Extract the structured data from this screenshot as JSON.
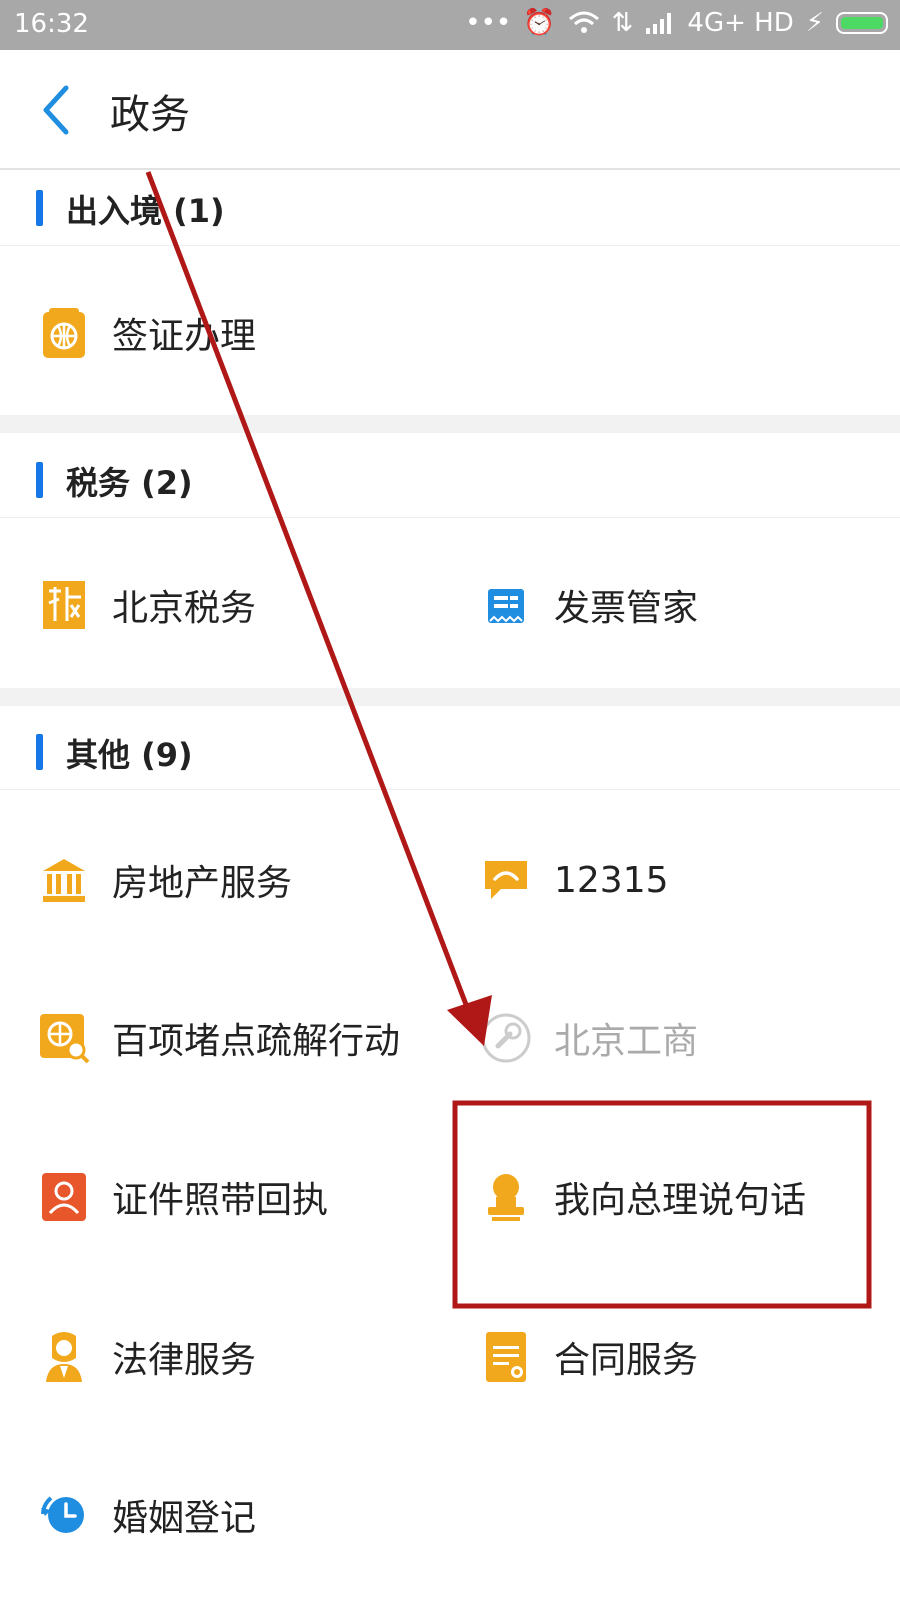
{
  "status_bar": {
    "time": "16:32",
    "network": "4G+ HD"
  },
  "header": {
    "title": "政务"
  },
  "sections": [
    {
      "title": "出入境 (1)",
      "items": [
        {
          "label": "签证办理",
          "icon": "passport-globe-icon",
          "color": "#f2a81d"
        }
      ]
    },
    {
      "title": "税务 (2)",
      "items": [
        {
          "label": "北京税务",
          "icon": "tax-stamp-icon",
          "color": "#f2a81d"
        },
        {
          "label": "发票管家",
          "icon": "invoice-icon",
          "color": "#1f8de0"
        }
      ]
    },
    {
      "title": "其他 (9)",
      "items": [
        {
          "label": "房地产服务",
          "icon": "bank-building-icon",
          "color": "#f2a81d"
        },
        {
          "label": "12315",
          "icon": "speech-bubble-icon",
          "color": "#f2a81d"
        },
        {
          "label": "百项堵点疏解行动",
          "icon": "globe-search-icon",
          "color": "#f2a81d"
        },
        {
          "label": "北京工商",
          "icon": "wrench-circle-icon",
          "color": "#cccccc"
        },
        {
          "label": "证件照带回执",
          "icon": "id-photo-icon",
          "color": "#e8562c"
        },
        {
          "label": "我向总理说句话",
          "icon": "stamp-person-icon",
          "color": "#f2a81d"
        },
        {
          "label": "法律服务",
          "icon": "judge-icon",
          "color": "#f2a81d"
        },
        {
          "label": "合同服务",
          "icon": "contract-icon",
          "color": "#f2a81d"
        },
        {
          "label": "婚姻登记",
          "icon": "marriage-clock-icon",
          "color": "#1f8de0"
        }
      ]
    }
  ],
  "annotation": {
    "arrow_color": "#b01818",
    "highlight_color": "#b01818"
  }
}
